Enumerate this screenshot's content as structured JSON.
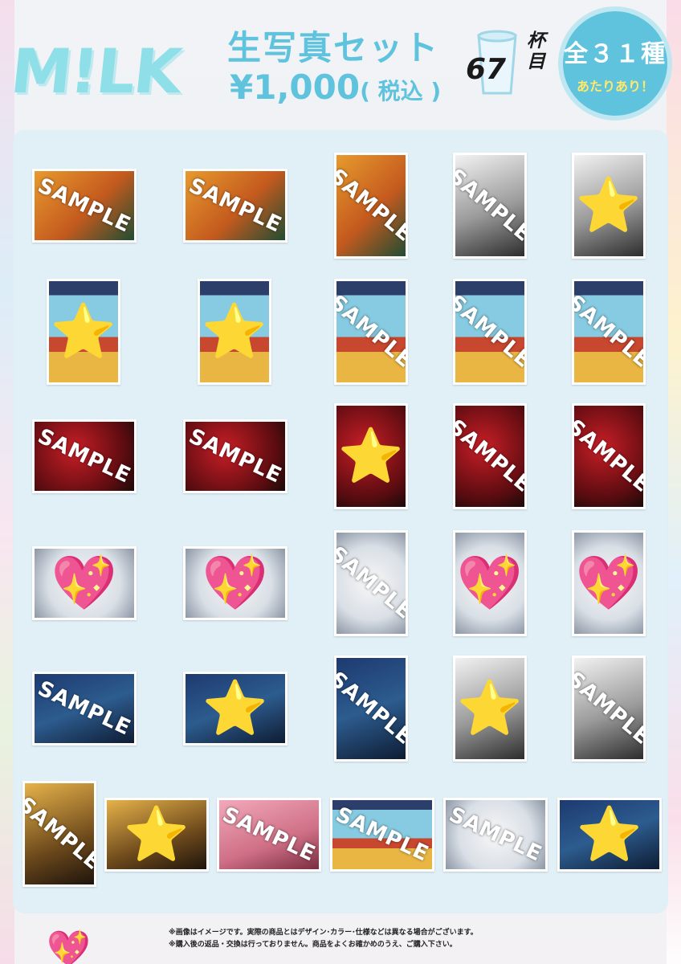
{
  "header": {
    "logo_text": "M!LK",
    "set_title": "生写真セット",
    "price": "¥1,000",
    "tax_note": "( 税込 )",
    "cup_number": "67",
    "cup_suffix": "杯目",
    "badge_line1": "全３１種",
    "badge_line2": "あたりあり！"
  },
  "colors": {
    "accent": "#5fc3dd",
    "logo": "#8edfe8",
    "badge_highlight": "#ffe86a",
    "panel": "#dfeef5"
  },
  "watermark": "SAMPLE",
  "photos": [
    {
      "orient": "land",
      "theme": "orange",
      "label": "SAMPLE"
    },
    {
      "orient": "land",
      "theme": "orange",
      "label": "SAMPLE"
    },
    {
      "orient": "port",
      "theme": "orange",
      "label": "SAMPLE"
    },
    {
      "orient": "port",
      "theme": "gray",
      "label": "SAMPLE"
    },
    {
      "orient": "port",
      "theme": "gray",
      "cover": "⭐"
    },
    {
      "orient": "port",
      "theme": "beach",
      "cover": "⭐"
    },
    {
      "orient": "port",
      "theme": "beach",
      "cover": "⭐"
    },
    {
      "orient": "port",
      "theme": "beach",
      "label": "SAMPLE"
    },
    {
      "orient": "port",
      "theme": "beach",
      "label": "SAMPLE"
    },
    {
      "orient": "port",
      "theme": "beach",
      "label": "SAMPLE"
    },
    {
      "orient": "land",
      "theme": "red",
      "label": "SAMPLE"
    },
    {
      "orient": "land",
      "theme": "red",
      "label": "SAMPLE"
    },
    {
      "orient": "port",
      "theme": "red",
      "cover": "⭐"
    },
    {
      "orient": "port",
      "theme": "red",
      "label": "SAMPLE"
    },
    {
      "orient": "port",
      "theme": "red",
      "label": "SAMPLE"
    },
    {
      "orient": "land",
      "theme": "white",
      "cover": "💖"
    },
    {
      "orient": "land",
      "theme": "white",
      "cover": "💖"
    },
    {
      "orient": "port",
      "theme": "white",
      "label": "SAMPLE"
    },
    {
      "orient": "port",
      "theme": "white",
      "cover": "💖"
    },
    {
      "orient": "port",
      "theme": "white",
      "cover": "💖"
    },
    {
      "orient": "land",
      "theme": "night",
      "label": "SAMPLE"
    },
    {
      "orient": "land",
      "theme": "night",
      "cover": "⭐"
    },
    {
      "orient": "port",
      "theme": "night",
      "label": "SAMPLE"
    },
    {
      "orient": "port",
      "theme": "gray",
      "cover": "⭐"
    },
    {
      "orient": "port",
      "theme": "gray",
      "label": "SAMPLE"
    },
    {
      "orient": "port",
      "theme": "warm",
      "label": "SAMPLE"
    },
    {
      "orient": "land",
      "theme": "warm",
      "cover": "⭐"
    },
    {
      "orient": "land",
      "theme": "pink",
      "label": "SAMPLE"
    },
    {
      "orient": "land",
      "theme": "beach",
      "label": "SAMPLE"
    },
    {
      "orient": "land",
      "theme": "white",
      "label": "SAMPLE"
    },
    {
      "orient": "land",
      "theme": "night",
      "cover": "⭐"
    }
  ],
  "footer": {
    "note1": "※画像はイメージです。実際の商品とはデザイン･カラー･仕様などは異なる場合がございます。",
    "note2": "※購入後の返品・交換は行っておりません。商品をよくお確かめのうえ、ご購入下さい。",
    "decor": "💖"
  }
}
